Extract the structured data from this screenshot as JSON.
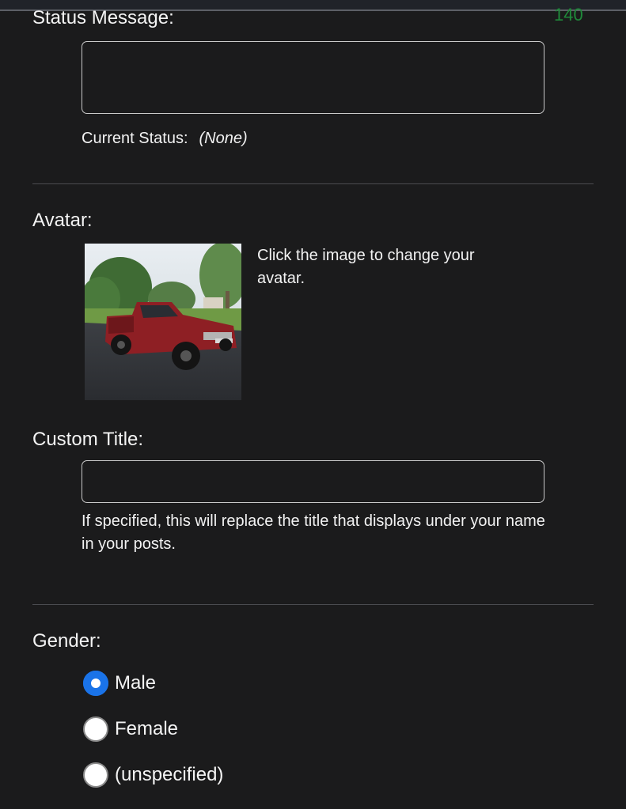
{
  "status": {
    "label": "Status Message:",
    "counter": "140",
    "value": "",
    "current_label": "Current Status:",
    "current_value": "(None)"
  },
  "avatar": {
    "label": "Avatar:",
    "help": "Click the image to change your avatar.",
    "image": "red-pickup-truck-photo"
  },
  "custom_title": {
    "label": "Custom Title:",
    "value": "",
    "help": "If specified, this will replace the title that displays under your name in your posts."
  },
  "gender": {
    "label": "Gender:",
    "options": [
      {
        "label": "Male",
        "checked": true
      },
      {
        "label": "Female",
        "checked": false
      },
      {
        "label": "(unspecified)",
        "checked": false
      }
    ]
  },
  "colors": {
    "background": "#1b1b1c",
    "counter": "#1f8a3a",
    "radio_accent": "#1a73e8"
  }
}
